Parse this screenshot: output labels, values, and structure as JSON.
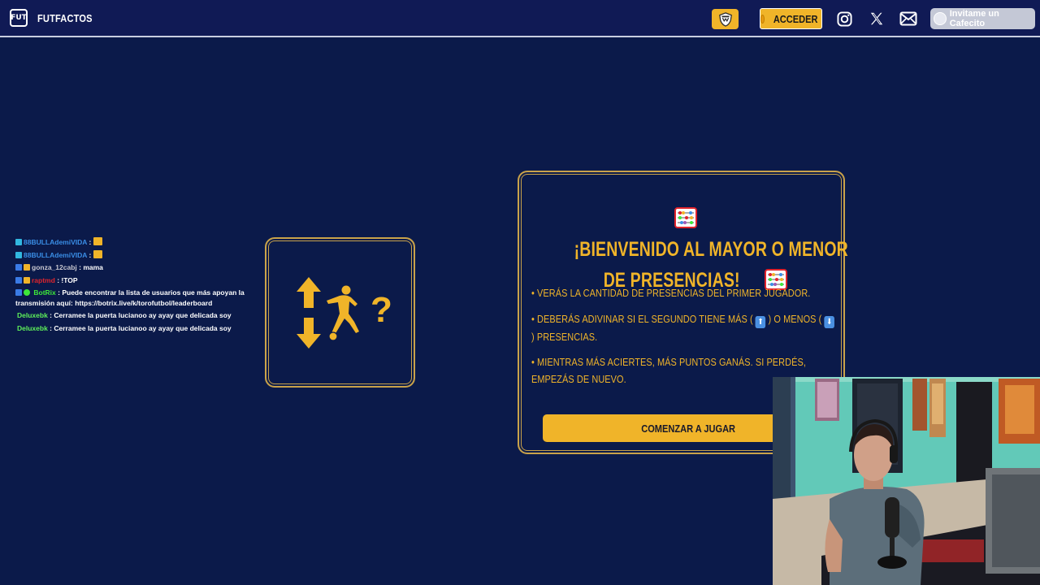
{
  "header": {
    "brand_logo": "FUT",
    "brand_name": "FUTFACTOS",
    "login_label": "ACCEDER",
    "coffee_label": "Invitame un Cafecito",
    "icons": [
      "shield-badge-icon",
      "instagram-icon",
      "x-icon",
      "mail-icon",
      "coffee-icon"
    ]
  },
  "chat": {
    "lines": [
      {
        "user": "88BULLAdemiVIDA",
        "msg": ":",
        "color": "#3a8ee6"
      },
      {
        "user": "88BULLAdemiVIDA",
        "msg": ":",
        "color": "#3a8ee6"
      },
      {
        "user": "gonza_12cabj",
        "msg": ": mama",
        "color": "#c8c8d0"
      },
      {
        "user": "raptmd",
        "msg": ": !TOP",
        "color": "#e0242c"
      },
      {
        "user": "BotRix",
        "msg": ": Puede encontrar la lista de usuarios que más apoyan la transmisión aquí: https://botrix.live/k/torofutbol/leaderboard",
        "color": "#3ee83a"
      },
      {
        "user": "Deluxebk",
        "msg": ": Cerramee la puerta lucianoo ay ayay que delicada soy",
        "color": "#5ef05a"
      },
      {
        "user": "Deluxebk",
        "msg": ": Cerramee la puerta lucianoo ay ayay que delicada soy",
        "color": "#5ef05a"
      }
    ]
  },
  "welcome": {
    "title_line1": "¡BIENVENIDO AL MAYOR O MENOR",
    "title_line2": "DE PRESENCIAS!",
    "rule1": "• VERÁS LA CANTIDAD DE PRESENCIAS DEL PRIMER JUGADOR.",
    "rule2_a": "• DEBERÁS ADIVINAR SI EL SEGUNDO TIENE MÁS (",
    "rule2_b": ") O MENOS (",
    "rule2_c": ") PRESENCIAS.",
    "rule3": "• MIENTRAS MÁS ACIERTES, MÁS PUNTOS GANÁS. SI PERDÉS, EMPEZÁS DE NUEVO.",
    "arrow_up": "⬆",
    "arrow_down": "⬇",
    "start_label": "COMENZAR A JUGAR",
    "accent_color": "#f0b429"
  },
  "icon_card": {
    "question": "?"
  }
}
